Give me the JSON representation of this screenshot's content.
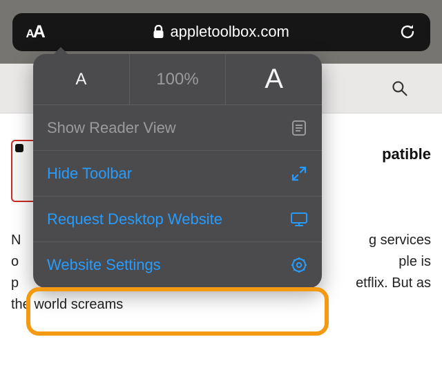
{
  "address_bar": {
    "aa_small": "A",
    "aa_large": "A",
    "domain": "appletoolbox.com"
  },
  "popover": {
    "zoom": {
      "decrease": "A",
      "percent": "100%",
      "increase": "A"
    },
    "reader_label": "Show Reader View",
    "hide_toolbar_label": "Hide Toolbar",
    "request_desktop_label": "Request Desktop Website",
    "website_settings_label": "Website Settings"
  },
  "article": {
    "title_suffix": "patible",
    "snippet_line1_prefix": "N",
    "snippet_line1_suffix": "g services",
    "snippet_line2_prefix": "o",
    "snippet_line2_suffix": "ple is",
    "snippet_line3_prefix": "p",
    "snippet_line3_suffix": "etflix. But as",
    "snippet_line4": "the world screams"
  }
}
